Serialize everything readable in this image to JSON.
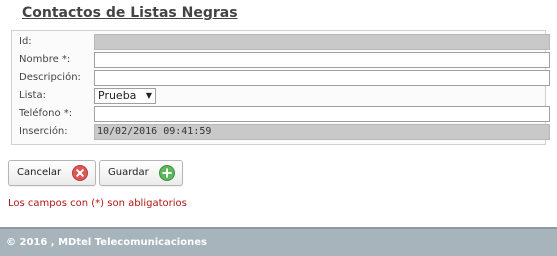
{
  "page": {
    "title": "Contactos de Listas Negras"
  },
  "form": {
    "id": {
      "label": "Id:",
      "value": ""
    },
    "nombre": {
      "label": "Nombre *:",
      "value": ""
    },
    "descripcion": {
      "label": "Descripción:",
      "value": ""
    },
    "lista": {
      "label": "Lista:",
      "selected": "Prueba"
    },
    "telefono": {
      "label": "Teléfono *:",
      "value": ""
    },
    "insercion": {
      "label": "Inserción:",
      "value": "10/02/2016 09:41:59"
    }
  },
  "buttons": {
    "cancel_label": "Cancelar",
    "save_label": "Guardar"
  },
  "note": "Los campos con (*) son abligatorios",
  "footer": {
    "text": "© 2016 , MDtel Telecomunicaciones"
  },
  "colors": {
    "cancel_icon": "#e05555",
    "save_icon": "#5cb85c",
    "note_text": "#b01515",
    "footer_bg": "#a7b4bb"
  },
  "icons": {
    "cancel": "close-circle-icon",
    "save": "plus-circle-icon"
  }
}
